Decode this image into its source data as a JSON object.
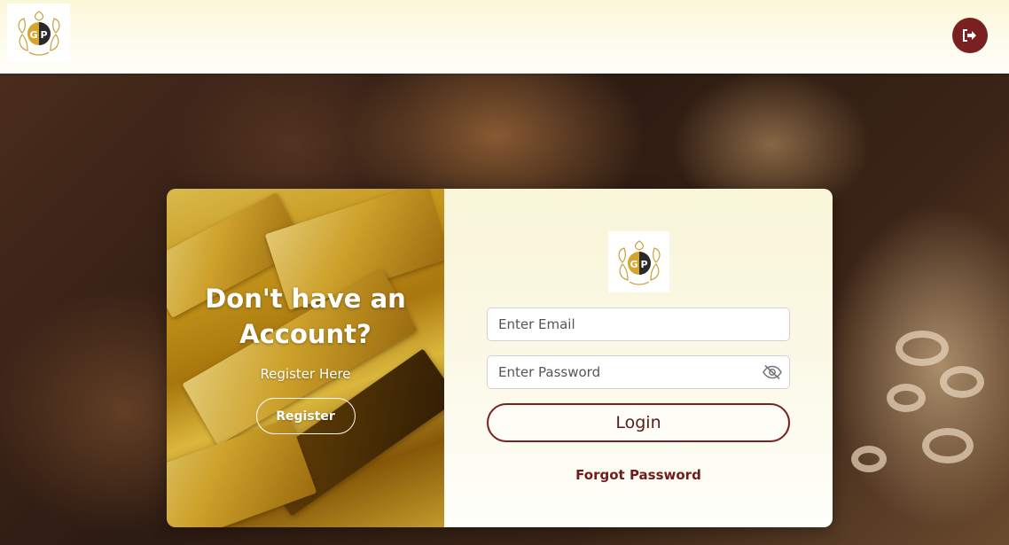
{
  "header": {
    "logo_text": "GP"
  },
  "register_panel": {
    "title": "Don't have an Account?",
    "subtitle": "Register Here",
    "register_label": "Register"
  },
  "login_form": {
    "logo_text": "GP",
    "email_placeholder": "Enter Email",
    "password_placeholder": "Enter Password",
    "login_label": "Login",
    "forgot_label": "Forgot Password"
  },
  "colors": {
    "accent": "#7a2020",
    "header_bg": "#fbf8d8",
    "gold": "#d9a821"
  },
  "icons": {
    "logout": "logout-icon",
    "password_toggle": "eye-slash-icon"
  }
}
